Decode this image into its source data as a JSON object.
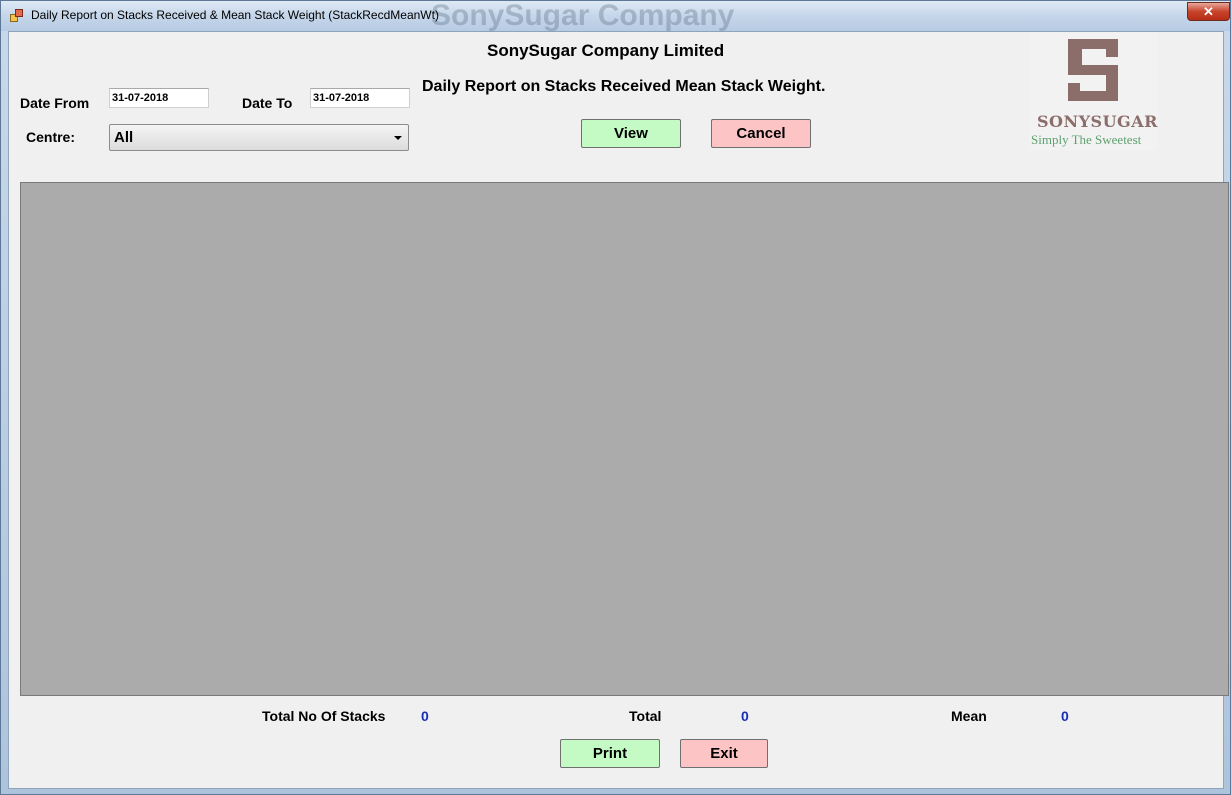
{
  "window": {
    "title": "Daily Report on Stacks Received & Mean Stack Weight (StackRecdMeanWt)",
    "background_title": "SonySugar Company",
    "close_label": "✕"
  },
  "header": {
    "company": "SonySugar Company Limited",
    "subtitle": "Daily Report on Stacks Received  Mean Stack Weight."
  },
  "filters": {
    "date_from_label": "Date From",
    "date_from_value": "31-07-2018",
    "date_to_label": "Date To",
    "date_to_value": "31-07-2018",
    "centre_label": "Centre:",
    "centre_value": "All"
  },
  "actions": {
    "view_label": "View",
    "cancel_label": "Cancel",
    "print_label": "Print",
    "exit_label": "Exit"
  },
  "logo": {
    "name": "SONYSUGAR",
    "tagline": "Simply The Sweetest"
  },
  "totals": {
    "stacks_label": "Total No Of Stacks",
    "stacks_value": "0",
    "total_label": "Total",
    "total_value": "0",
    "mean_label": "Mean",
    "mean_value": "0"
  },
  "colors": {
    "green_button": "#c4fbc4",
    "red_button": "#fcc4c4",
    "value_text": "#1b2fb0",
    "grid_background": "#ababab"
  }
}
